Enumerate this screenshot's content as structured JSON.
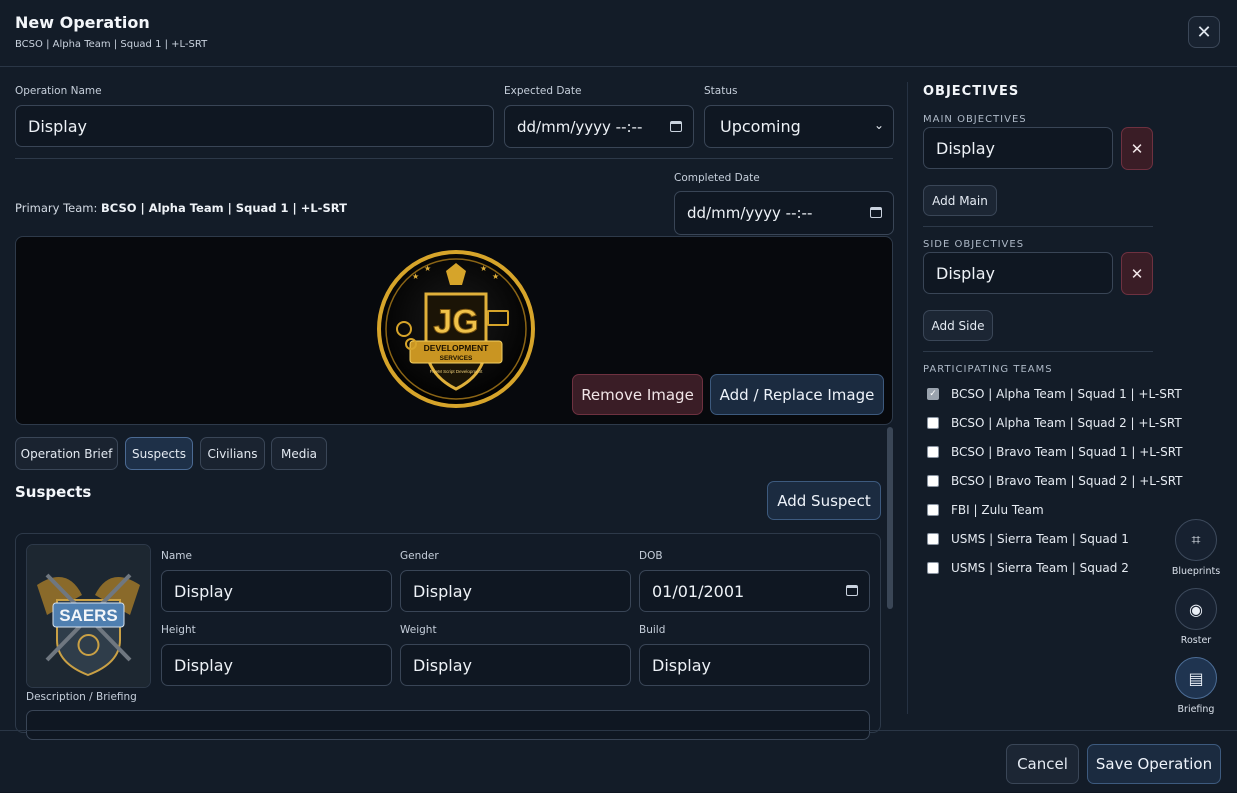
{
  "header": {
    "title": "New Operation",
    "subtitle": "BCSO | Alpha Team | Squad 1 | +L-SRT",
    "close_label": "✕"
  },
  "form": {
    "operation_name_label": "Operation Name",
    "operation_name_value": "Display",
    "expected_date_label": "Expected Date",
    "expected_date_value": "dd/mm/yyyy --:--",
    "status_label": "Status",
    "status_value": "Upcoming",
    "completed_date_label": "Completed Date",
    "completed_date_value": "dd/mm/yyyy --:--",
    "primary_team_prefix": "Primary Team:",
    "primary_team_value": "BCSO | Alpha Team | Squad 1 | +L-SRT"
  },
  "image_panel": {
    "logo_main": "JG",
    "logo_line1": "DEVELOPMENT",
    "logo_line2": "SERVICES",
    "logo_tagline": "FiveM Script Development",
    "remove_label": "Remove Image",
    "replace_label": "Add / Replace Image"
  },
  "tabs": [
    {
      "label": "Operation Brief",
      "active": false
    },
    {
      "label": "Suspects",
      "active": true
    },
    {
      "label": "Civilians",
      "active": false
    },
    {
      "label": "Media",
      "active": false
    }
  ],
  "suspects": {
    "heading": "Suspects",
    "add_label": "Add Suspect",
    "photo_badge": "SAERS",
    "fields": {
      "name_label": "Name",
      "name_value": "Display",
      "gender_label": "Gender",
      "gender_value": "Display",
      "dob_label": "DOB",
      "dob_value": "01/01/2001",
      "height_label": "Height",
      "height_value": "Display",
      "weight_label": "Weight",
      "weight_value": "Display",
      "build_label": "Build",
      "build_value": "Display",
      "description_label": "Description / Briefing"
    }
  },
  "objectives": {
    "heading": "OBJECTIVES",
    "main_label": "MAIN OBJECTIVES",
    "main_value": "Display",
    "add_main_label": "Add Main",
    "side_label": "SIDE OBJECTIVES",
    "side_value": "Display",
    "add_side_label": "Add Side",
    "remove_label": "✕"
  },
  "participating": {
    "heading": "PARTICIPATING TEAMS",
    "teams": [
      {
        "label": "BCSO | Alpha Team | Squad 1 | +L-SRT",
        "checked": true
      },
      {
        "label": "BCSO | Alpha Team | Squad 2 | +L-SRT",
        "checked": false
      },
      {
        "label": "BCSO | Bravo Team | Squad 1 | +L-SRT",
        "checked": false
      },
      {
        "label": "BCSO | Bravo Team | Squad 2 | +L-SRT",
        "checked": false
      },
      {
        "label": "FBI | Zulu Team",
        "checked": false
      },
      {
        "label": "USMS | Sierra Team | Squad 1",
        "checked": false
      },
      {
        "label": "USMS | Sierra Team | Squad 2",
        "checked": false
      }
    ]
  },
  "rail": [
    {
      "label": "Blueprints",
      "icon": "grid-icon",
      "glyph": "⌗",
      "active": false
    },
    {
      "label": "Roster",
      "icon": "target-icon",
      "glyph": "◉",
      "active": false
    },
    {
      "label": "Briefing",
      "icon": "document-icon",
      "glyph": "▤",
      "active": true
    }
  ],
  "footer": {
    "cancel_label": "Cancel",
    "save_label": "Save Operation"
  },
  "colors": {
    "background": "#131c28",
    "accent_blue": "#1b2b40",
    "danger": "#3a1d26",
    "gold": "#d6a42a"
  }
}
